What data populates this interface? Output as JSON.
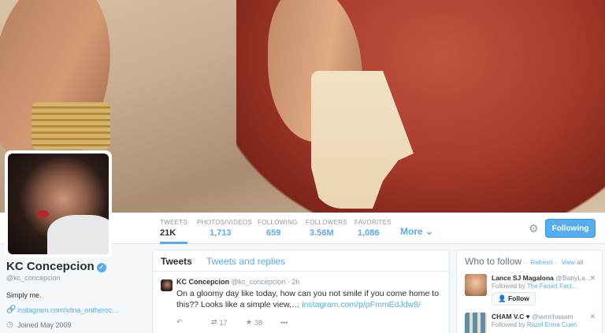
{
  "profile": {
    "name": "KC Concepcion",
    "handle": "@kc_concepcion",
    "bio": "Simply me.",
    "website": "instagram.com/xtina_ontheroc...",
    "joined": "Joined May 2009",
    "verified_glyph": "✓"
  },
  "nav": {
    "stats": [
      {
        "label": "TWEETS",
        "value": "21K"
      },
      {
        "label": "PHOTOS/VIDEOS",
        "value": "1,713"
      },
      {
        "label": "FOLLOWING",
        "value": "659"
      },
      {
        "label": "FOLLOWERS",
        "value": "3.56M"
      },
      {
        "label": "FAVORITES",
        "value": "1,086"
      }
    ],
    "more_label": "More",
    "following_label": "Following"
  },
  "timeline": {
    "tab_tweets": "Tweets",
    "tab_replies": "Tweets and replies",
    "tweet": {
      "author": "KC Concepcion",
      "handle": "@kc_concepcion",
      "time": "· 2h",
      "text": "On a gloomy day like today, how can you not smile if you come home to this?? Looks like a simple view,… ",
      "link": "instagram.com/p/pFmmEdJdw8/",
      "retweets": "17",
      "favorites": "38"
    }
  },
  "who_to_follow": {
    "title": "Who to follow",
    "refresh": "Refresh",
    "separator": "·",
    "view_all": "View all",
    "followed_by": "Followed by",
    "follow_label": "Follow",
    "suggestions": [
      {
        "name": "Lance SJ Magalona",
        "handle": "@BabyLa...",
        "by": "The Fanart Fact..."
      },
      {
        "name": "CHAM V.C ♥",
        "handle": "@iamchaaam",
        "by": "Razel Erma Cuen"
      }
    ]
  },
  "icons": {
    "link": "link-icon",
    "calendar": "calendar-icon",
    "gear": "gear-icon",
    "reply": "reply-icon",
    "retweet": "retweet-icon",
    "favorite": "star-icon",
    "more_dots": "more-dots-icon"
  },
  "colors": {
    "accent": "#55acee",
    "text": "#292f33",
    "muted": "#8899a6",
    "background": "#f5f8fa"
  }
}
